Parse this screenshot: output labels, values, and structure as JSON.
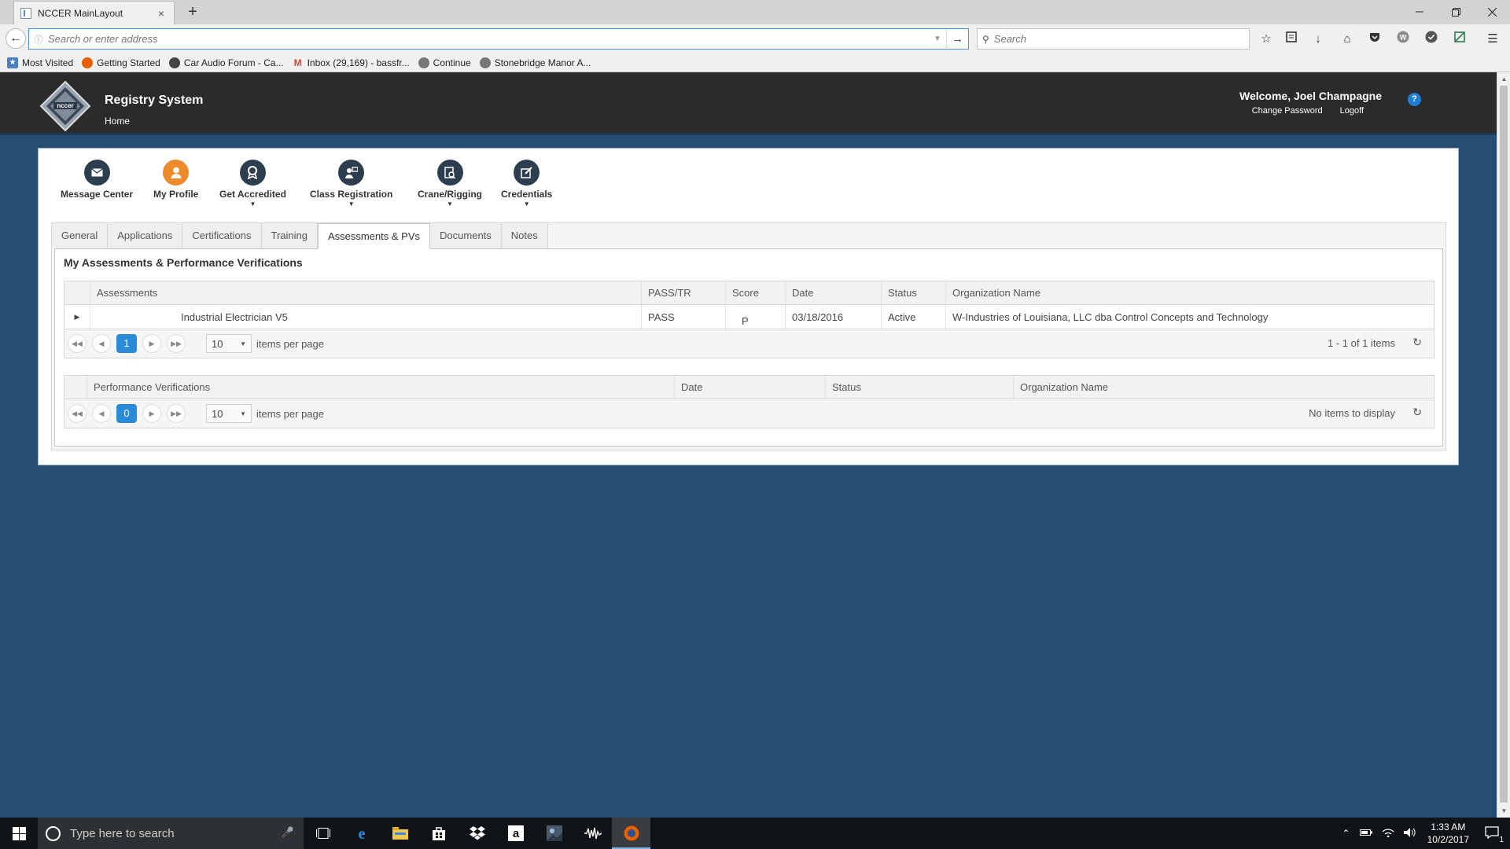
{
  "browser": {
    "tab_title": "NCCER MainLayout",
    "tab_close": "×",
    "new_tab": "+",
    "address_placeholder": "Search or enter address",
    "search_placeholder": "Search",
    "bookmarks": [
      {
        "label": "Most Visited",
        "icon": "bookmark-star-icon",
        "color": "#4a7fc1"
      },
      {
        "label": "Getting Started",
        "icon": "firefox-icon",
        "color": "#e66000"
      },
      {
        "label": "Car Audio Forum - Ca...",
        "icon": "forum-icon",
        "color": "#444444"
      },
      {
        "label": "Inbox (29,169) - bassfr...",
        "icon": "gmail-icon",
        "color": "#d44638"
      },
      {
        "label": "Continue",
        "icon": "globe-icon",
        "color": "#777777"
      },
      {
        "label": "Stonebridge Manor A...",
        "icon": "globe-icon",
        "color": "#777777"
      }
    ]
  },
  "header": {
    "title": "Registry System",
    "crumb": "Home",
    "welcome": "Welcome, Joel Champagne",
    "change_password": "Change Password",
    "logoff": "Logoff",
    "help": "?"
  },
  "nav": [
    {
      "label": "Message Center",
      "icon": "envelope-icon"
    },
    {
      "label": "My Profile",
      "icon": "user-icon",
      "color": "#ed8b2c"
    },
    {
      "label": "Get Accredited",
      "icon": "award-icon"
    },
    {
      "label": "Class Registration",
      "icon": "class-registration-icon"
    },
    {
      "label": "Crane/Rigging",
      "icon": "document-search-icon"
    },
    {
      "label": "Credentials",
      "icon": "edit-icon"
    }
  ],
  "tabs": [
    "General",
    "Applications",
    "Certifications",
    "Training",
    "Assessments & PVs",
    "Documents",
    "Notes"
  ],
  "active_tab": "Assessments & PVs",
  "section_title": "My Assessments & Performance Verifications",
  "assessments": {
    "columns": [
      "Assessments",
      "PASS/TR",
      "Score",
      "Date",
      "Status",
      "Organization Name"
    ],
    "rows": [
      {
        "assessment": "Industrial Electrician V5",
        "pass": "PASS",
        "score": "P",
        "date": "03/18/2016",
        "status": "Active",
        "org": "W-Industries of Louisiana, LLC dba Control Concepts and Technology"
      }
    ],
    "page": "1",
    "page_size": "10",
    "items_per_page": "items per page",
    "info": "1 - 1 of 1 items"
  },
  "pvs": {
    "columns": [
      "Performance Verifications",
      "Date",
      "Status",
      "Organization Name"
    ],
    "page": "0",
    "page_size": "10",
    "items_per_page": "items per page",
    "info": "No items to display"
  },
  "taskbar": {
    "search_placeholder": "Type here to search",
    "time": "1:33 AM",
    "date": "10/2/2017",
    "notifications": "1"
  },
  "colors": {
    "page_bg": "#264e73",
    "header_bg": "#2b2b2b",
    "accent": "#2a8bd8",
    "orange": "#ed8b2c"
  }
}
